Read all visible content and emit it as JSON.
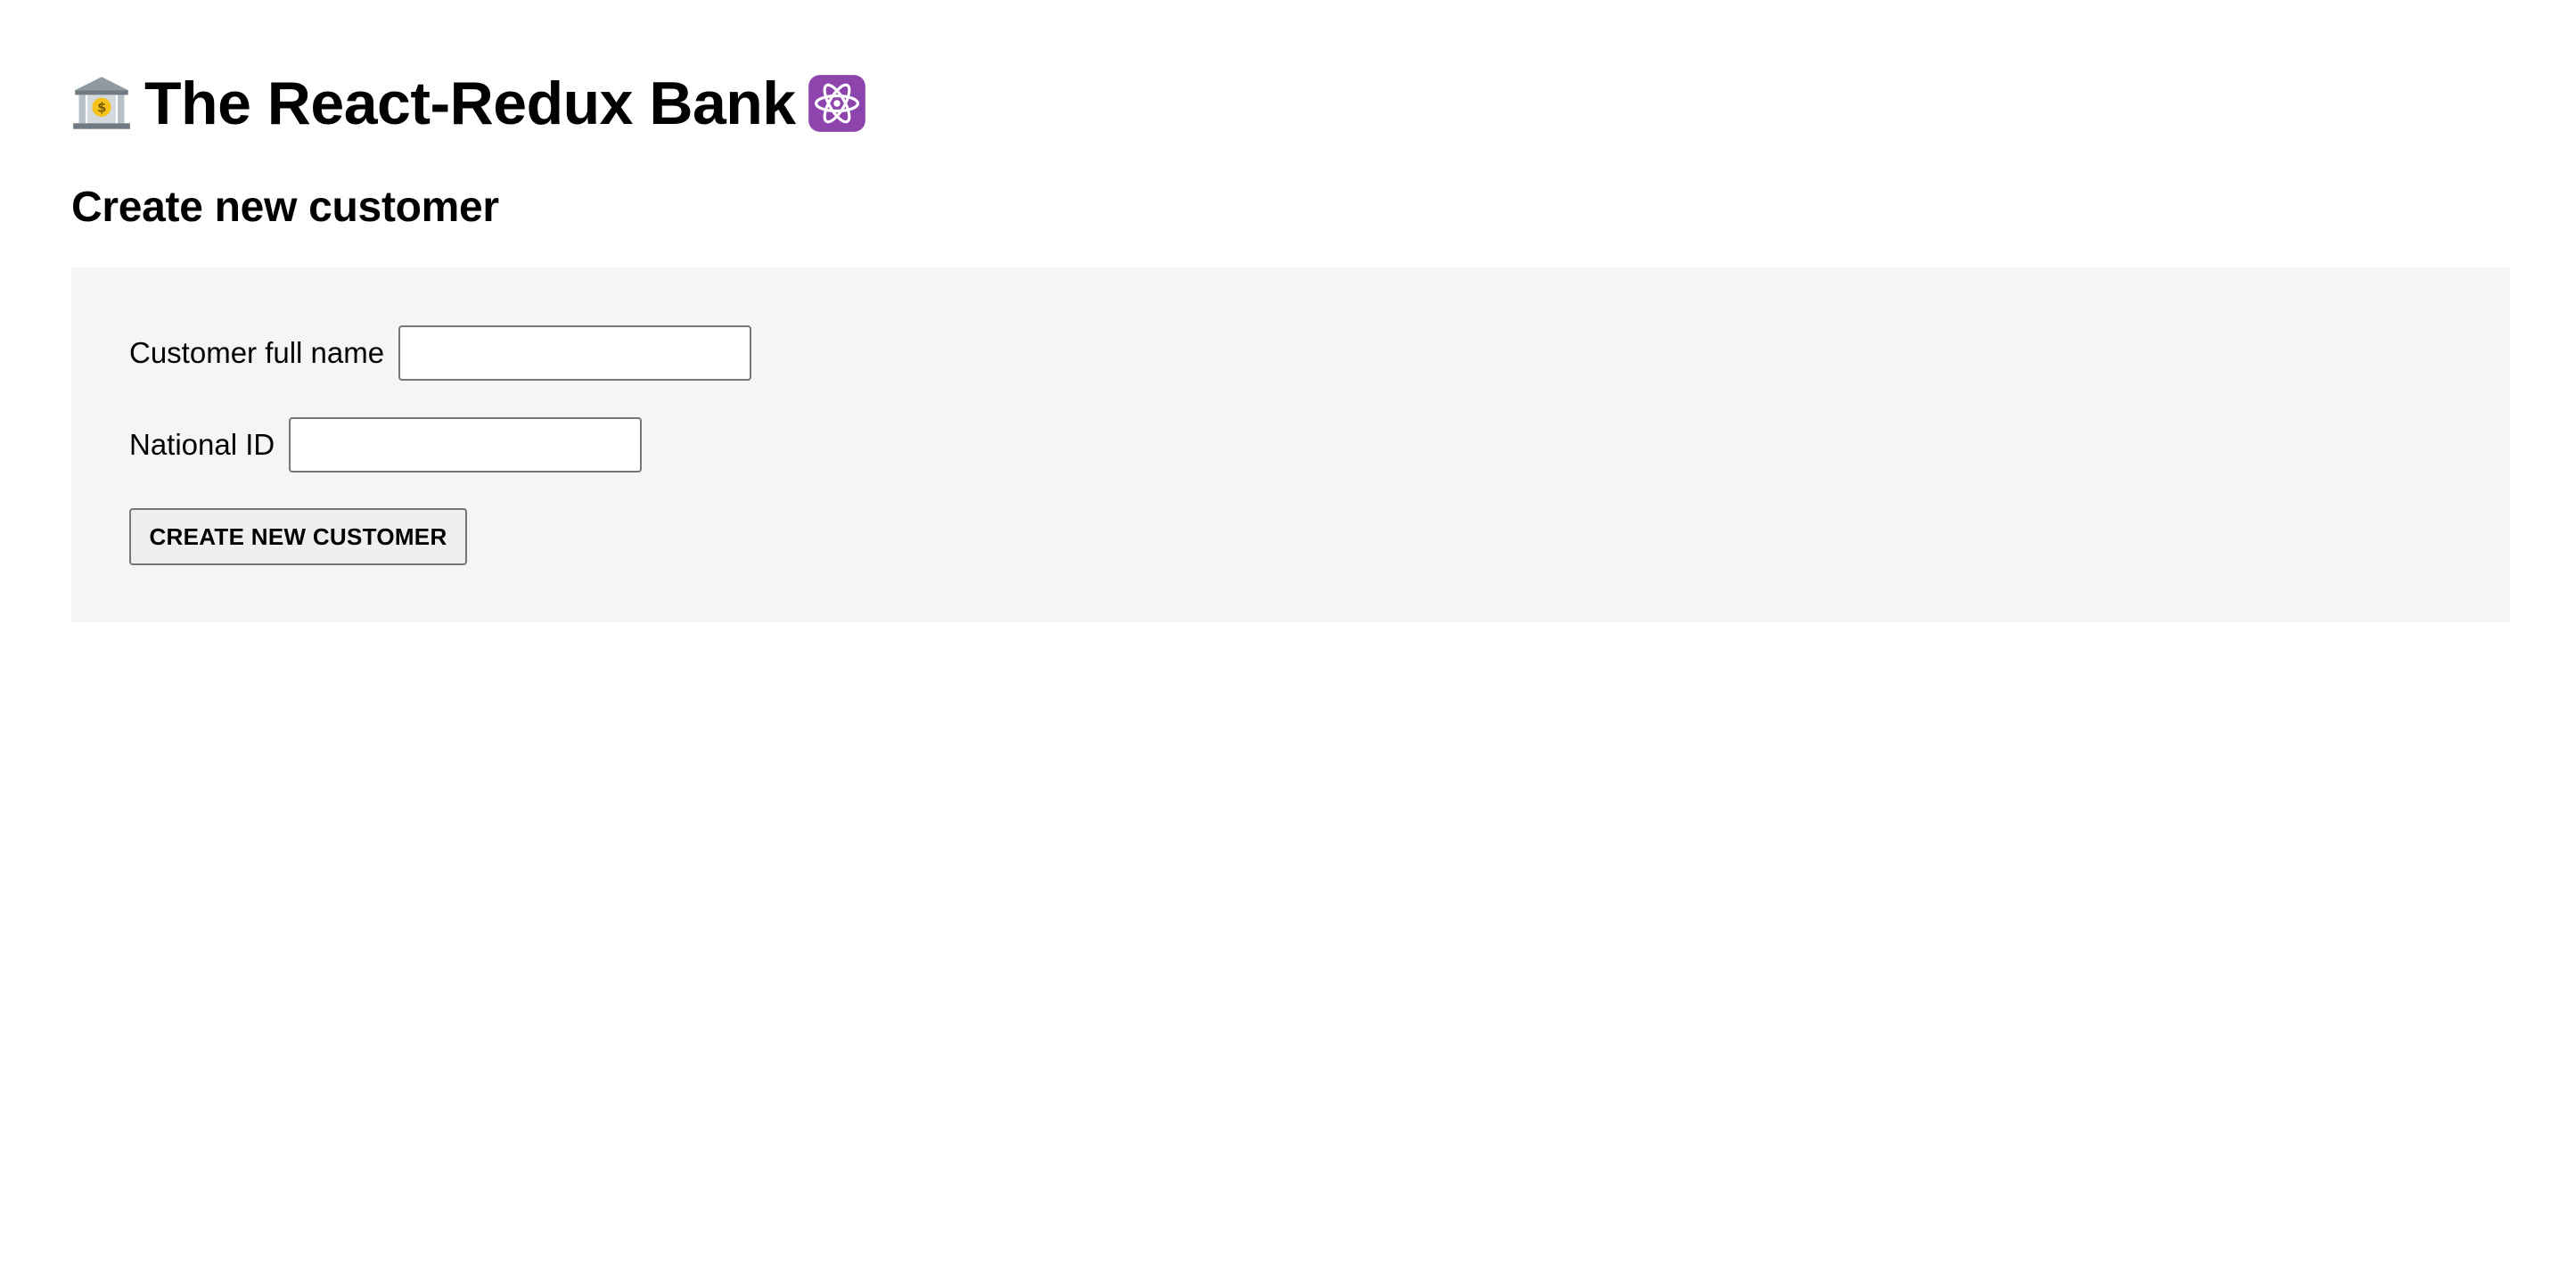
{
  "app": {
    "title": "The React-Redux Bank",
    "leading_icon": "bank-icon",
    "trailing_icon": "atom-icon"
  },
  "create_customer": {
    "heading": "Create new customer",
    "full_name_label": "Customer full name",
    "full_name_value": "",
    "national_id_label": "National ID",
    "national_id_value": "",
    "submit_label": "CREATE NEW CUSTOMER"
  },
  "colors": {
    "panel_background": "#f5f5f5",
    "atom_badge": "#8e44ad",
    "bank_roof": "#9aa3ab",
    "coin": "#f4c21b"
  }
}
